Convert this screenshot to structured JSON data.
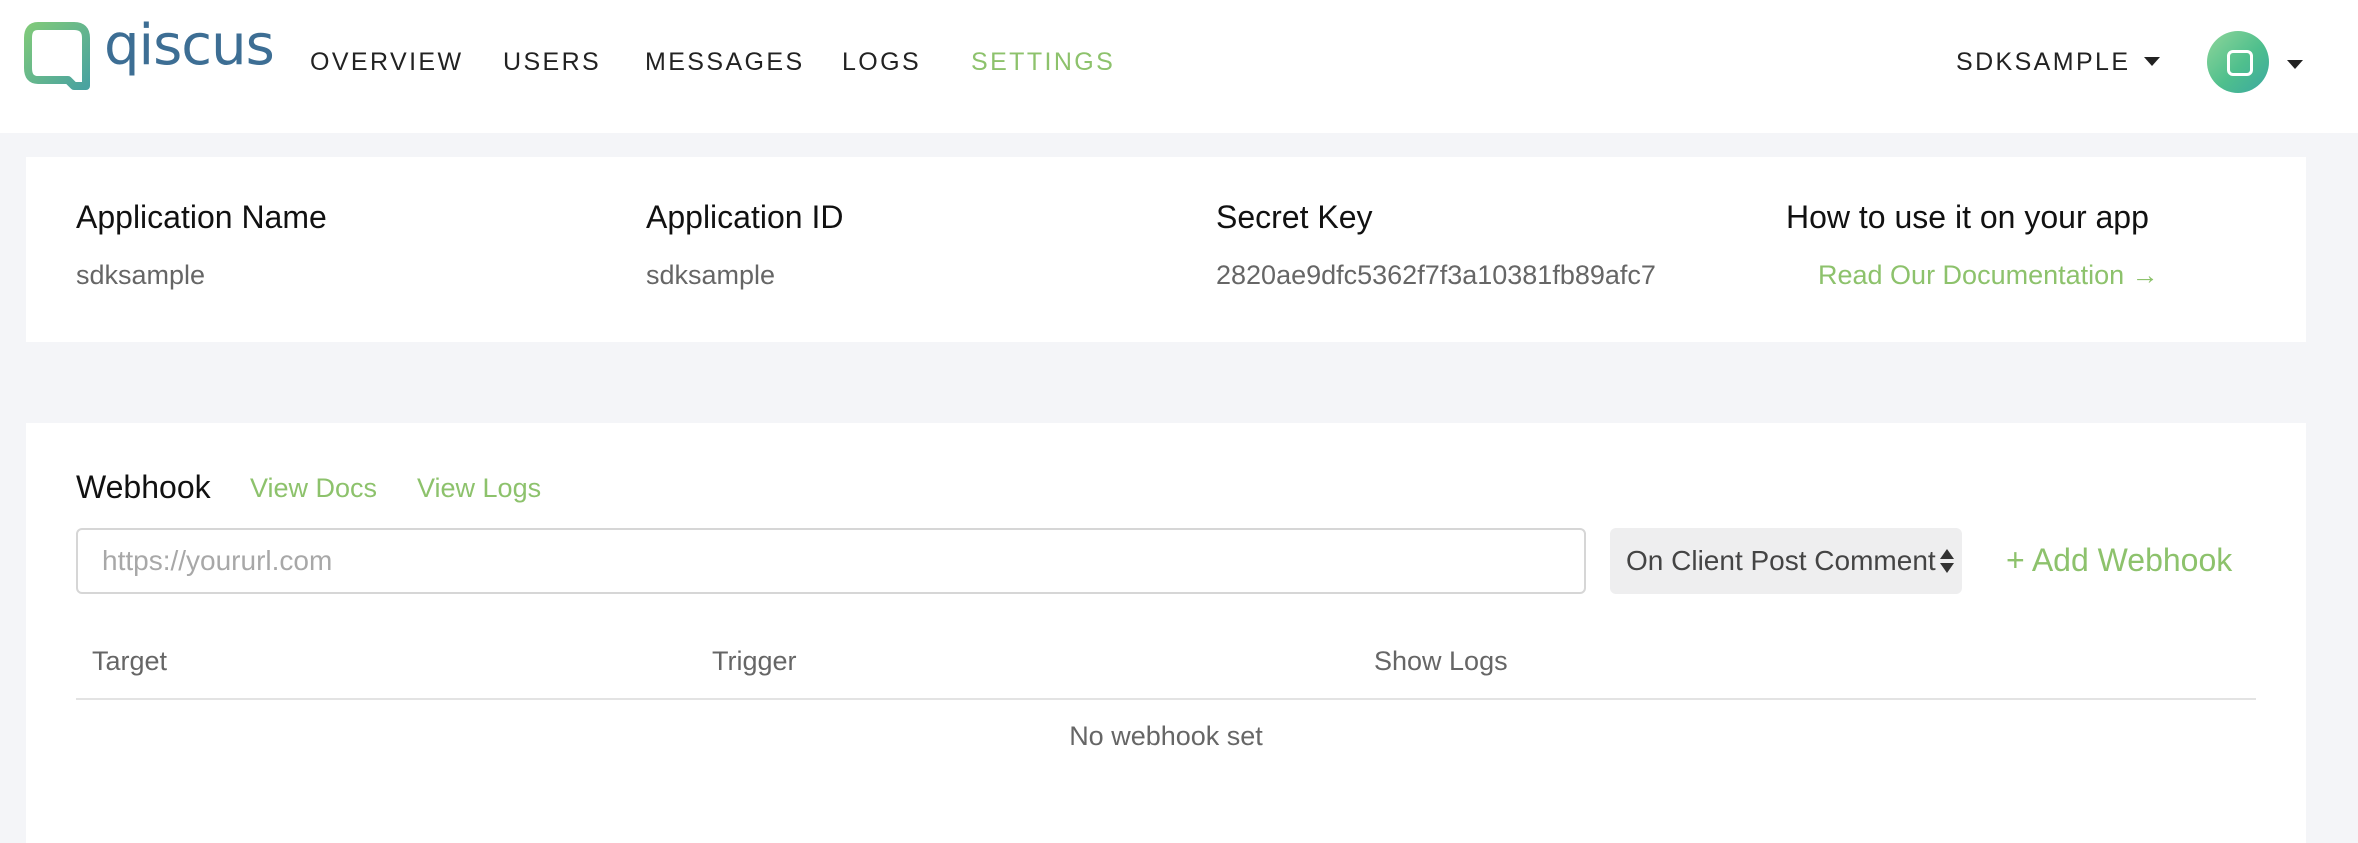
{
  "brand": {
    "logo_text": "qiscus",
    "accent_color": "#8dc26c",
    "logo_color": "#3d6e94"
  },
  "nav": {
    "items": [
      {
        "label": "OVERVIEW",
        "active": false
      },
      {
        "label": "USERS",
        "active": false
      },
      {
        "label": "MESSAGES",
        "active": false
      },
      {
        "label": "LOGS",
        "active": false
      },
      {
        "label": "SETTINGS",
        "active": true
      }
    ],
    "app_selector": "SDKSAMPLE"
  },
  "app_info": {
    "name_label": "Application Name",
    "name_value": "sdksample",
    "id_label": "Application ID",
    "id_value": "sdksample",
    "secret_label": "Secret Key",
    "secret_value": "2820ae9dfc5362f7f3a10381fb89afc7",
    "howto_label": "How to use it on your app",
    "docs_link": "Read Our Documentation →"
  },
  "webhook": {
    "title": "Webhook",
    "view_docs": "View Docs",
    "view_logs": "View Logs",
    "url_placeholder": "https://yoururl.com",
    "url_value": "",
    "trigger_selected": "On Client Post Comment",
    "add_label": "+ Add Webhook",
    "columns": [
      "Target",
      "Trigger",
      "Show Logs"
    ],
    "empty_message": "No webhook set"
  }
}
